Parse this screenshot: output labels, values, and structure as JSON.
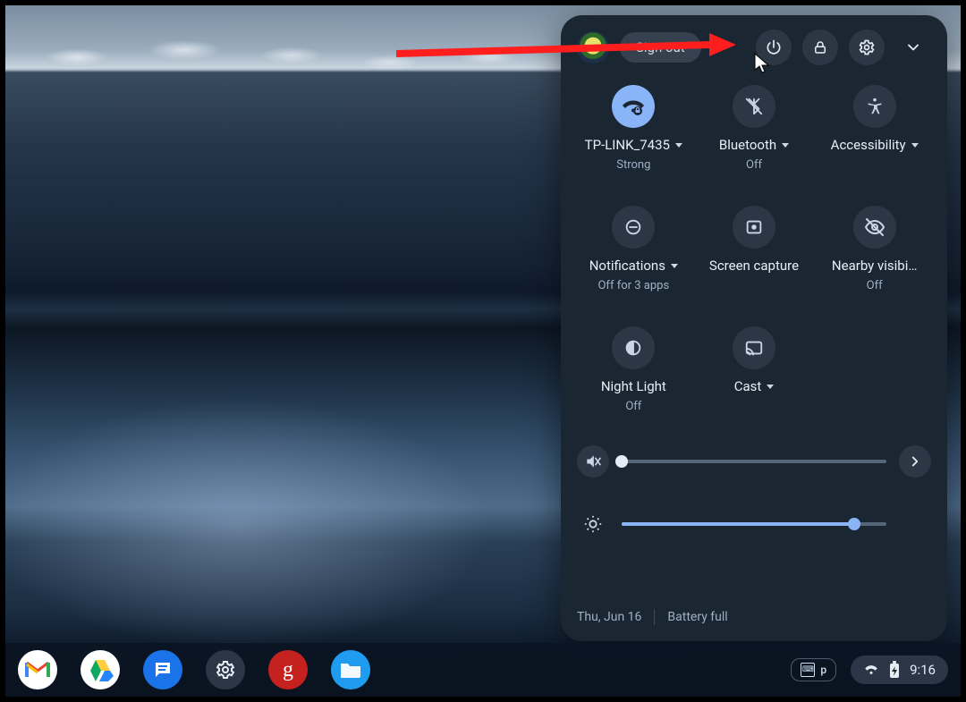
{
  "panel": {
    "sign_out": "Sign out",
    "tiles": {
      "wifi": {
        "label": "TP-LINK_7435",
        "sub": "Strong"
      },
      "bluetooth": {
        "label": "Bluetooth",
        "sub": "Off"
      },
      "accessibility": {
        "label": "Accessibility",
        "sub": ""
      },
      "notifications": {
        "label": "Notifications",
        "sub": "Off for 3 apps"
      },
      "screencapture": {
        "label": "Screen capture",
        "sub": ""
      },
      "nearby": {
        "label": "Nearby visibi…",
        "sub": "Off"
      },
      "nightlight": {
        "label": "Night Light",
        "sub": "Off"
      },
      "cast": {
        "label": "Cast",
        "sub": ""
      }
    },
    "sliders": {
      "volume_pct": 0,
      "brightness_pct": 88
    },
    "date": "Thu, Jun 16",
    "battery": "Battery full"
  },
  "tray": {
    "keybadge": "p",
    "clock": "9:16"
  },
  "colors": {
    "panel_bg": "#1b2633",
    "tile_bg": "#2c3745",
    "tile_active": "#8ab4f8",
    "text": "#e8eef6",
    "subtext": "#9fb0c4",
    "slider_track": "#55657a",
    "slider_fill": "#8ab4f8"
  }
}
